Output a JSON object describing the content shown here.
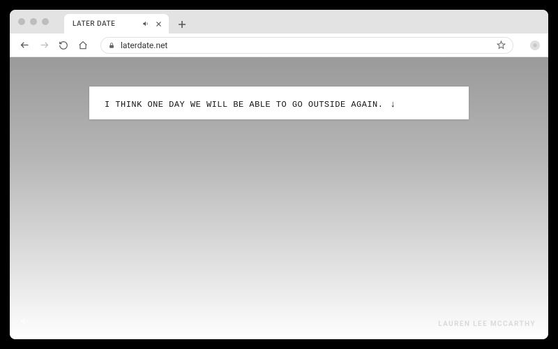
{
  "browser": {
    "tab": {
      "title": "LATER DATE"
    },
    "url": "laterdate.net"
  },
  "page": {
    "message": "I THINK ONE DAY WE WILL BE ABLE TO GO OUTSIDE AGAIN.",
    "arrow_glyph": "↓",
    "credit": "LAUREN LEE MCCARTHY"
  }
}
